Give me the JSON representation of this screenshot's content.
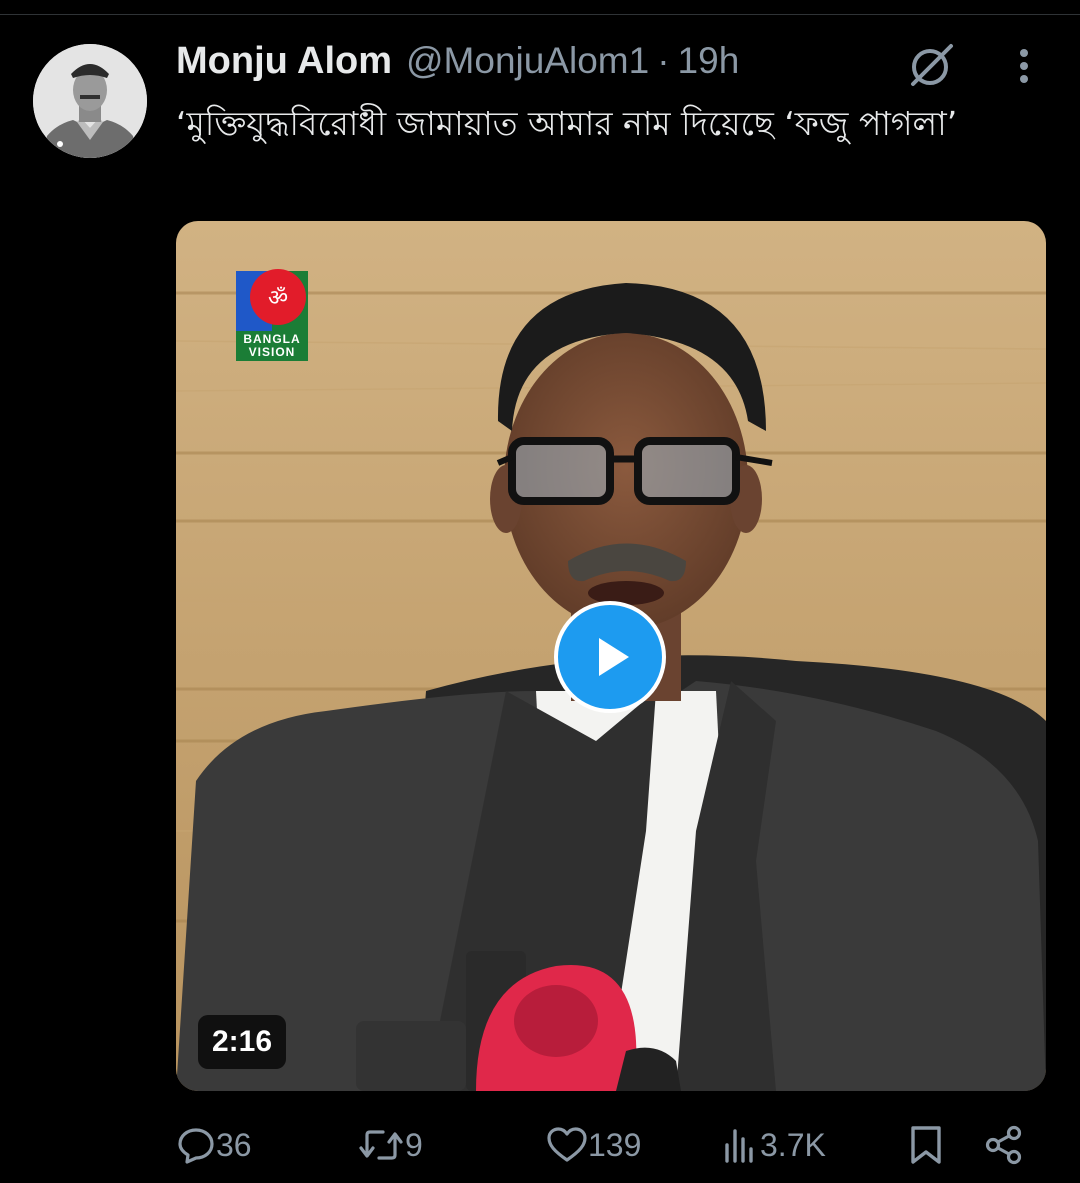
{
  "tweet": {
    "author_name": "Monju Alom",
    "handle": "@MonjuAlom1",
    "separator": "·",
    "time": "19h",
    "text": "‘মুক্তিযুদ্ধবিরোধী জামায়াত আমার নাম দিয়েছে ‘ফজু পাগলা’"
  },
  "media": {
    "type": "video",
    "channel_logo_text": "BANGLA VISION",
    "duration": "2:16"
  },
  "actions": {
    "replies": "36",
    "reposts": "9",
    "likes": "139",
    "views": "3.7K"
  },
  "icons": {
    "avatar": "profile-photo",
    "grok": "grok-icon",
    "more": "more-vertical-icon",
    "play": "play-icon",
    "reply": "reply-icon",
    "repost": "repost-icon",
    "like": "heart-icon",
    "views": "views-icon",
    "bookmark": "bookmark-icon",
    "share": "share-icon"
  },
  "colors": {
    "background": "#000000",
    "primary_text": "#e7e9ea",
    "secondary_text": "#8b98a5",
    "accent": "#1d9bf0"
  }
}
